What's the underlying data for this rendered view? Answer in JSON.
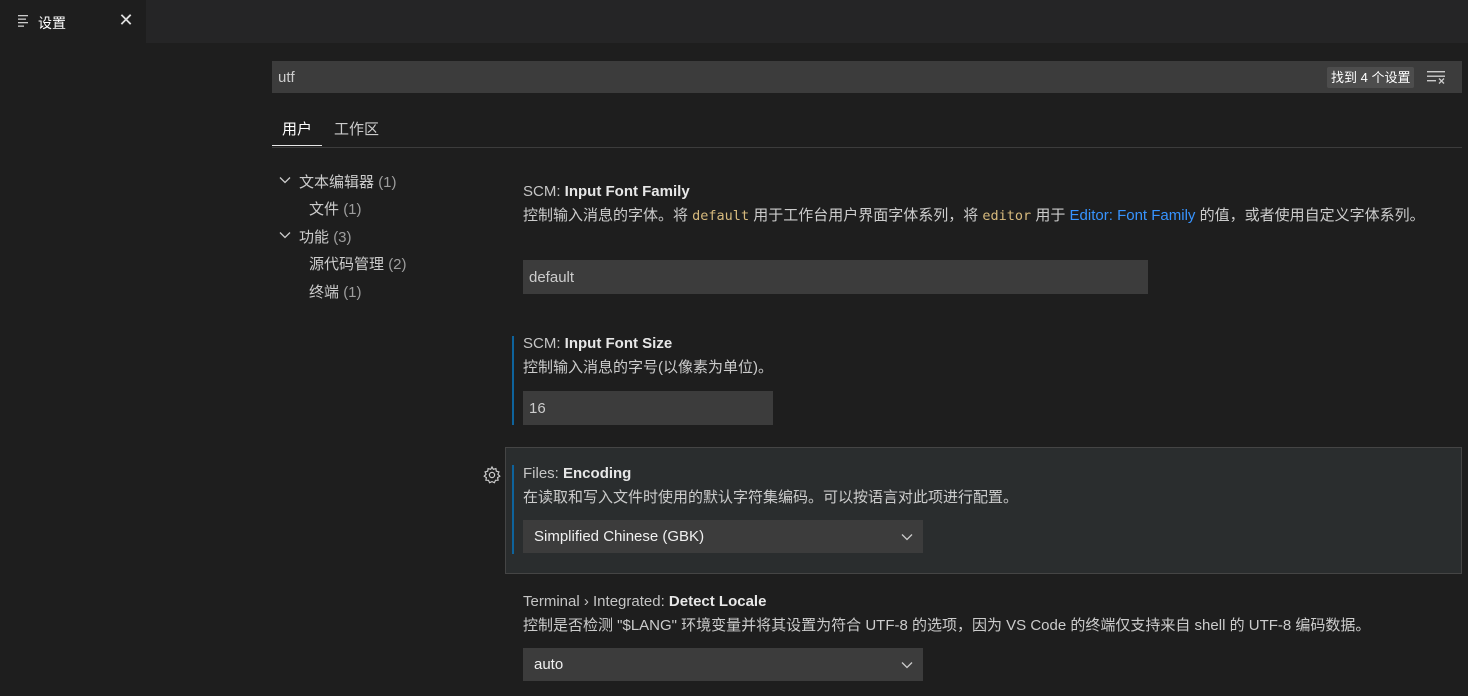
{
  "tab": {
    "title": "设置",
    "close_glyph": "✕",
    "icon": "settings-list-icon"
  },
  "search": {
    "value": "utf",
    "result_count": "找到 4 个设置",
    "filter_icon": "clear-filter-icon"
  },
  "scope_tabs": [
    {
      "label": "用户",
      "active": true
    },
    {
      "label": "工作区",
      "active": false
    }
  ],
  "toc": [
    {
      "label": "文本编辑器",
      "count": "(1)",
      "level": 0,
      "expanded": true
    },
    {
      "label": "文件",
      "count": "(1)",
      "level": 1
    },
    {
      "label": "功能",
      "count": "(3)",
      "level": 0,
      "expanded": true
    },
    {
      "label": "源代码管理",
      "count": "(2)",
      "level": 1
    },
    {
      "label": "终端",
      "count": "(1)",
      "level": 1
    }
  ],
  "settings": {
    "scm_font_family": {
      "category": "SCM: ",
      "name": "Input Font Family",
      "desc_1": "控制输入消息的字体。将 ",
      "code_1": "default",
      "desc_2": " 用于工作台用户界面字体系列，将 ",
      "code_2": "editor",
      "desc_3": " 用于 ",
      "link": "Editor: Font Family",
      "desc_4": " 的值，或者使用自定义字体系列。",
      "value": "default"
    },
    "scm_font_size": {
      "category": "SCM: ",
      "name": "Input Font Size",
      "desc": "控制输入消息的字号(以像素为单位)。",
      "value": "16"
    },
    "files_encoding": {
      "category": "Files: ",
      "name": "Encoding",
      "desc": "在读取和写入文件时使用的默认字符集编码。可以按语言对此项进行配置。",
      "value": "Simplified Chinese (GBK)"
    },
    "terminal_detect_locale": {
      "category": "Terminal › Integrated: ",
      "name": "Detect Locale",
      "desc": "控制是否检测 \"$LANG\" 环境变量并将其设置为符合 UTF-8 的选项，因为 VS Code 的终端仅支持来自 shell 的 UTF-8 编码数据。",
      "value": "auto"
    }
  },
  "colors": {
    "accent": "#0e639c",
    "link": "#3794ff",
    "code": "#d7ba7d"
  }
}
